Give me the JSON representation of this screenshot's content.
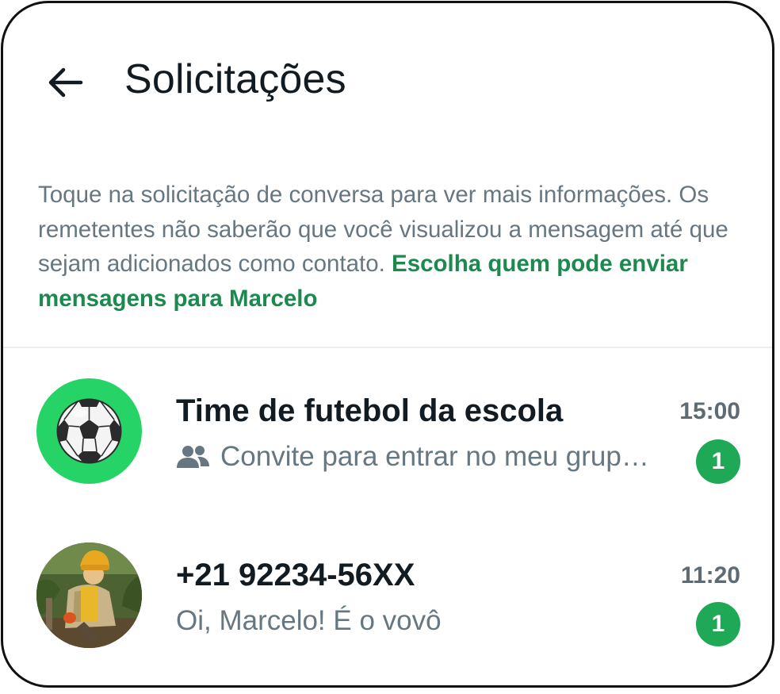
{
  "header": {
    "title": "Solicitações",
    "back_icon": "arrow-left-icon"
  },
  "info": {
    "text": "Toque na solicitação de conversa para ver mais informações. Os remetentes não saberão que você visualizou a mensagem até que sejam adicionados como contato. ",
    "link": "Escolha quem pode enviar mensagens para Marcelo"
  },
  "colors": {
    "accent": "#1c8a4f",
    "badge": "#1fa855",
    "avatar_ring": "#25d366",
    "secondary_text": "#667781",
    "primary_text": "#111b21"
  },
  "requests": [
    {
      "name": "Time de futebol da escola",
      "time": "15:00",
      "message": "Convite para entrar no meu grup…",
      "message_icon": "group-icon",
      "unread": "1",
      "avatar": "soccer-ball-icon"
    },
    {
      "name": "+21 92234-56XX",
      "time": "11:20",
      "message": "Oi, Marcelo! É o vovô",
      "unread": "1",
      "avatar": "person-photo"
    }
  ]
}
